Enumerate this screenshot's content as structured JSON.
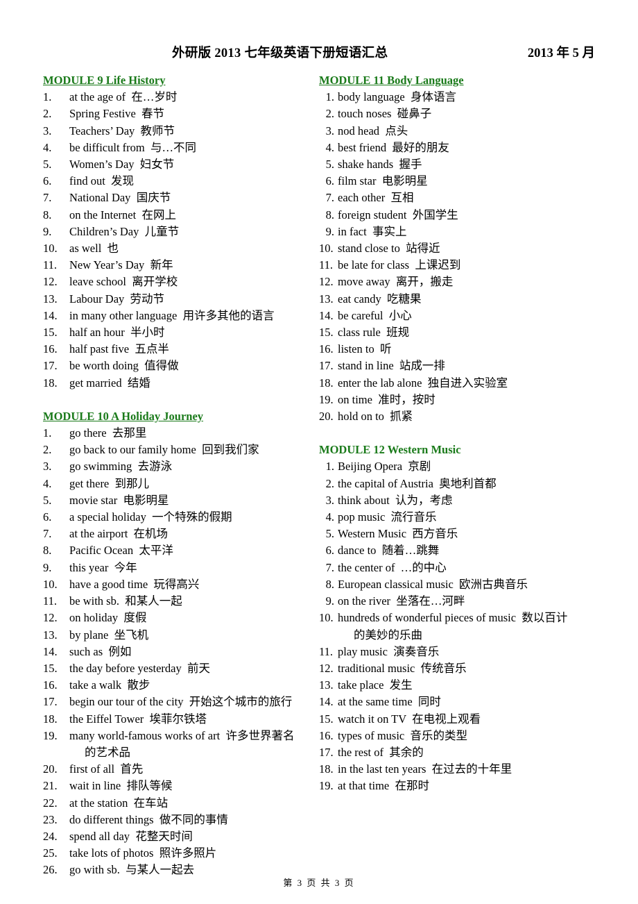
{
  "header": {
    "title": "外研版 2013 七年级英语下册短语汇总",
    "date": "2013 年 5 月"
  },
  "footer": {
    "page_label": "第 3 页 共 3 页"
  },
  "colors": {
    "module_heading": "#1a7a1a",
    "text": "#000000",
    "background": "#ffffff"
  },
  "left_column": {
    "modules": [
      {
        "heading": "MODULE 9 Life History",
        "underlined": true,
        "items": [
          {
            "num": "1.",
            "en": "at the age of",
            "zh": "在…岁时"
          },
          {
            "num": "2.",
            "en": "Spring Festive",
            "zh": "春节"
          },
          {
            "num": "3.",
            "en": "Teachers’ Day",
            "zh": "教师节"
          },
          {
            "num": "4.",
            "en": "be difficult from",
            "zh": "与…不同"
          },
          {
            "num": "5.",
            "en": "Women’s Day",
            "zh": "妇女节"
          },
          {
            "num": "6.",
            "en": "find out",
            "zh": "发现"
          },
          {
            "num": "7.",
            "en": "National Day",
            "zh": "国庆节"
          },
          {
            "num": "8.",
            "en": "on the Internet",
            "zh": "在网上"
          },
          {
            "num": "9.",
            "en": "Children’s Day",
            "zh": "儿童节"
          },
          {
            "num": "10.",
            "en": "as well",
            "zh": "也"
          },
          {
            "num": "11.",
            "en": "New Year’s Day",
            "zh": "新年"
          },
          {
            "num": "12.",
            "en": "leave school",
            "zh": "离开学校"
          },
          {
            "num": "13.",
            "en": "Labour Day",
            "zh": "劳动节"
          },
          {
            "num": "14.",
            "en": "in many other language",
            "zh": "用许多其他的语言"
          },
          {
            "num": "15.",
            "en": "half an hour",
            "zh": "半小时"
          },
          {
            "num": "16.",
            "en": "half past five",
            "zh": "五点半"
          },
          {
            "num": "17.",
            "en": "be worth doing",
            "zh": "值得做"
          },
          {
            "num": "18.",
            "en": "get married",
            "zh": "结婚"
          }
        ]
      },
      {
        "heading": "MODULE 10 A Holiday Journey",
        "underlined": true,
        "items": [
          {
            "num": "1.",
            "en": "go there",
            "zh": "去那里"
          },
          {
            "num": "2.",
            "en": "go back to our family home",
            "zh": "回到我们家"
          },
          {
            "num": "3.",
            "en": "go swimming",
            "zh": "去游泳"
          },
          {
            "num": "4.",
            "en": "get there",
            "zh": "到那儿"
          },
          {
            "num": "5.",
            "en": "movie star",
            "zh": "电影明星"
          },
          {
            "num": "6.",
            "en": "a special holiday",
            "zh": "一个特殊的假期"
          },
          {
            "num": "7.",
            "en": "at the airport",
            "zh": "在机场"
          },
          {
            "num": "8.",
            "en": "Pacific Ocean",
            "zh": "太平洋"
          },
          {
            "num": "9.",
            "en": "this year",
            "zh": "今年"
          },
          {
            "num": "10.",
            "en": "have a good time",
            "zh": "玩得高兴"
          },
          {
            "num": "11.",
            "en": "be with sb.",
            "zh": "和某人一起"
          },
          {
            "num": "12.",
            "en": "on holiday",
            "zh": "度假"
          },
          {
            "num": "13.",
            "en": "by plane",
            "zh": "坐飞机"
          },
          {
            "num": "14.",
            "en": "such as",
            "zh": "例如"
          },
          {
            "num": "15.",
            "en": "the day before yesterday",
            "zh": "前天"
          },
          {
            "num": "16.",
            "en": "take a walk",
            "zh": "散步"
          },
          {
            "num": "17.",
            "en": "begin our tour of the city",
            "zh": "开始这个城市的旅行"
          },
          {
            "num": "18.",
            "en": "the Eiffel Tower",
            "zh": "埃菲尔铁塔"
          },
          {
            "num": "19.",
            "en": "many world-famous works of art",
            "zh": "许多世界著名",
            "wrap": "的艺术品"
          },
          {
            "num": "20.",
            "en": "first of all",
            "zh": "首先"
          },
          {
            "num": "21.",
            "en": "wait in line",
            "zh": "排队等候"
          },
          {
            "num": "22.",
            "en": "at the station",
            "zh": "在车站"
          },
          {
            "num": "23.",
            "en": "do different things",
            "zh": "做不同的事情"
          },
          {
            "num": "24.",
            "en": "spend all day",
            "zh": "花整天时间"
          },
          {
            "num": "25.",
            "en": "take lots of photos",
            "zh": "照许多照片"
          },
          {
            "num": "26.",
            "en": "go with sb.",
            "zh": "与某人一起去"
          }
        ]
      }
    ]
  },
  "right_column": {
    "modules": [
      {
        "heading": "MODULE 11 Body Language",
        "underlined": true,
        "items": [
          {
            "num": "1.",
            "en": "body language",
            "zh": "身体语言"
          },
          {
            "num": "2.",
            "en": "touch noses",
            "zh": "碰鼻子"
          },
          {
            "num": "3.",
            "en": "nod head",
            "zh": "点头"
          },
          {
            "num": "4.",
            "en": "best friend",
            "zh": "最好的朋友"
          },
          {
            "num": "5.",
            "en": "shake hands",
            "zh": "握手"
          },
          {
            "num": "6.",
            "en": "film star",
            "zh": "电影明星"
          },
          {
            "num": "7.",
            "en": "each other",
            "zh": "互相"
          },
          {
            "num": "8.",
            "en": "foreign student",
            "zh": "外国学生"
          },
          {
            "num": "9.",
            "en": "in fact",
            "zh": "事实上"
          },
          {
            "num": "10.",
            "en": "stand close to",
            "zh": "站得近",
            "tight": true
          },
          {
            "num": "11.",
            "en": "be late for class",
            "zh": "上课迟到",
            "tight": true
          },
          {
            "num": "12.",
            "en": "move away",
            "zh": "离开，搬走",
            "tight": true
          },
          {
            "num": "13.",
            "en": "eat candy",
            "zh": "吃糖果",
            "tight": true
          },
          {
            "num": "14.",
            "en": "be careful",
            "zh": "小心",
            "tight": true
          },
          {
            "num": "15.",
            "en": "class rule",
            "zh": "班规",
            "tight": true
          },
          {
            "num": "16.",
            "en": "listen to",
            "zh": "听",
            "tight": true
          },
          {
            "num": "17.",
            "en": "stand in line",
            "zh": "站成一排",
            "tight": true
          },
          {
            "num": "18.",
            "en": "enter the lab alone",
            "zh": "独自进入实验室",
            "tight": true
          },
          {
            "num": "19.",
            "en": "on time",
            "zh": "准时，按时",
            "tight": true
          },
          {
            "num": "20.",
            "en": "hold on to",
            "zh": "抓紧",
            "tight": true
          }
        ]
      },
      {
        "heading": "MODULE 12 Western Music",
        "underlined": false,
        "items": [
          {
            "num": "1.",
            "en": "Beijing Opera",
            "zh": "京剧"
          },
          {
            "num": "2.",
            "en": "the capital of Austria",
            "zh": "奥地利首都"
          },
          {
            "num": "3.",
            "en": "think about",
            "zh": "认为，考虑"
          },
          {
            "num": "4.",
            "en": "pop music",
            "zh": "流行音乐"
          },
          {
            "num": "5.",
            "en": "Western Music",
            "zh": "西方音乐"
          },
          {
            "num": "6.",
            "en": "dance to",
            "zh": "随着…跳舞"
          },
          {
            "num": "7.",
            "en": "the center of",
            "zh": "…的中心"
          },
          {
            "num": "8.",
            "en": "European classical music",
            "zh": "欧洲古典音乐"
          },
          {
            "num": "9.",
            "en": "on the river",
            "zh": "坐落在…河畔"
          },
          {
            "num": "10.",
            "en": "hundreds of wonderful pieces of music",
            "zh": "数以百计",
            "wrap": "的美妙的乐曲",
            "tight": true
          },
          {
            "num": "11.",
            "en": "play music",
            "zh": "演奏音乐",
            "tight": true
          },
          {
            "num": "12.",
            "en": "traditional music",
            "zh": "传统音乐",
            "tight": true
          },
          {
            "num": "13.",
            "en": "take place",
            "zh": "发生",
            "tight": true
          },
          {
            "num": "14.",
            "en": "at the same time",
            "zh": "同时",
            "tight": true
          },
          {
            "num": "15.",
            "en": "watch it on TV",
            "zh": "在电视上观看",
            "tight": true
          },
          {
            "num": "16.",
            "en": "types of music",
            "zh": "音乐的类型",
            "tight": true
          },
          {
            "num": "17.",
            "en": "the rest of",
            "zh": "其余的",
            "tight": true
          },
          {
            "num": "18.",
            "en": "in the last ten years",
            "zh": "在过去的十年里",
            "tight": true
          },
          {
            "num": "19.",
            "en": "at that time",
            "zh": "在那时",
            "tight": true
          }
        ]
      }
    ]
  }
}
